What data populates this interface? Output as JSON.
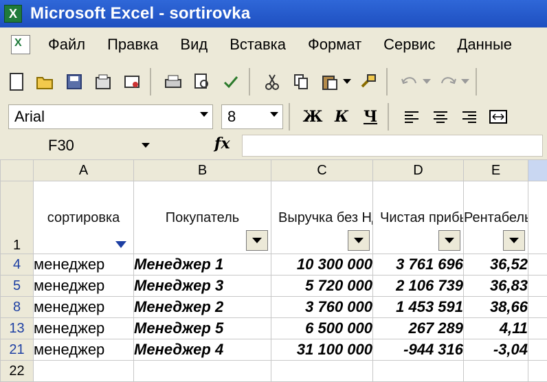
{
  "window": {
    "title": "Microsoft Excel - sortirovka"
  },
  "menu": {
    "items": [
      "Файл",
      "Правка",
      "Вид",
      "Вставка",
      "Формат",
      "Сервис",
      "Данные"
    ]
  },
  "format_bar": {
    "font": "Arial",
    "size": "8",
    "bold": "Ж",
    "italic": "К",
    "underline": "Ч"
  },
  "name_box": {
    "cell": "F30",
    "fx": "fx"
  },
  "columns": [
    "A",
    "B",
    "C",
    "D",
    "E"
  ],
  "header_row": {
    "row_num": "1",
    "a": "сортировка",
    "b": "Покупатель",
    "c": "Выручка без НДС",
    "d": "Чистая прибыль",
    "e": "Рентабельность, %"
  },
  "rows": [
    {
      "num": "4",
      "a": "менеджер",
      "b": "Менеджер 1",
      "c": "10 300 000",
      "d": "3 761 696",
      "e": "36,52"
    },
    {
      "num": "5",
      "a": "менеджер",
      "b": "Менеджер 3",
      "c": "5 720 000",
      "d": "2 106 739",
      "e": "36,83"
    },
    {
      "num": "8",
      "a": "менеджер",
      "b": "Менеджер 2",
      "c": "3 760 000",
      "d": "1 453 591",
      "e": "38,66"
    },
    {
      "num": "13",
      "a": "менеджер",
      "b": "Менеджер 5",
      "c": "6 500 000",
      "d": "267 289",
      "e": "4,11"
    },
    {
      "num": "21",
      "a": "менеджер",
      "b": "Менеджер 4",
      "c": "31 100 000",
      "d": "-944 316",
      "e": "-3,04"
    }
  ],
  "last_row": {
    "num": "22"
  }
}
